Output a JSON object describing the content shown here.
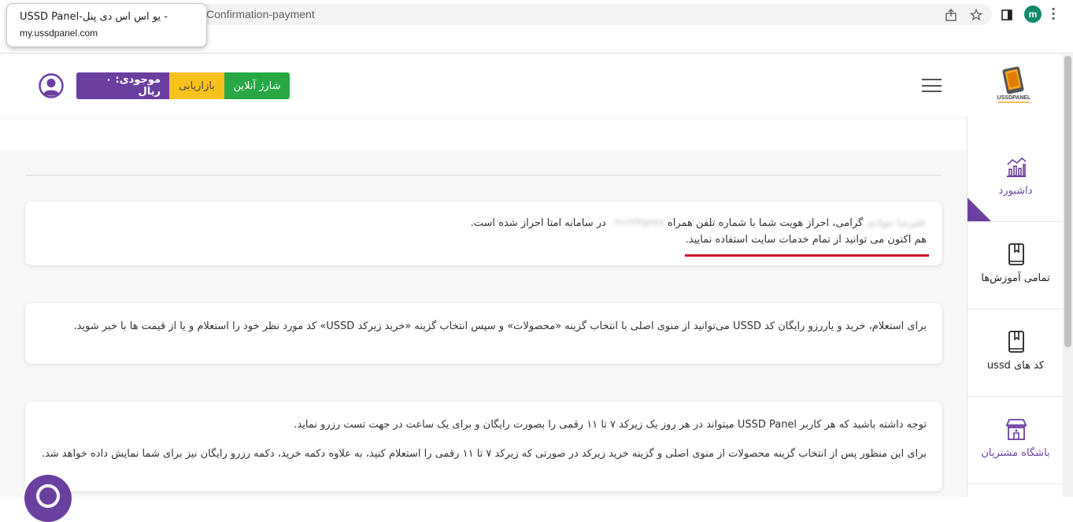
{
  "browser": {
    "address_text": "Confirmation-payment",
    "tooltip_title": "USSD Panel-یو اس اس دی پنل -",
    "tooltip_url": "my.ussdpanel.com",
    "profile_initial": "m"
  },
  "header": {
    "balance_label": "موجودی: ۰ ریال",
    "marketing_label": "بازاریابی",
    "charge_label": "شارژ آنلاین",
    "logo_text": "USSDPANEL"
  },
  "sidebar": {
    "items": [
      {
        "label": "داشبورد",
        "icon": "chart-icon",
        "active": true
      },
      {
        "label": "تمامی آموزش‌ها",
        "icon": "book-icon"
      },
      {
        "label": "کد های ussd",
        "icon": "book-icon"
      },
      {
        "label": "باشگاه مشتریان",
        "icon": "store-icon"
      }
    ]
  },
  "cards": {
    "verify_name": "علیرضا جوادی",
    "verify_line1_a": "گرامی، احراز هویت شما با شماره تلفن همراه",
    "verify_phone": "۰۹۱۲۳۴۵۶۷۸",
    "verify_line1_b": "در سامانه امتا احراز شده است.",
    "verify_line2": "هم اکنون می توانید از تمام خدمات سایت استفاده نمایید.",
    "info_text": "برای استعلام، خرید و یاررزو رایگان کد USSD می‌توانید از منوی اصلی با انتخاب گزینه «محصولات» و سپس انتخاب گزینه «خرید زیرکد USSD» کد مورد نظر خود را استعلام و یا از قیمت ها با خبر شوید.",
    "note_line1": "توجه داشته باشید که هر کاربر USSD Panel میتواند در هر روز یک زیرکد ۷ تا ۱۱ رقمی را بصورت رایگان و برای یک ساعت در جهت تست رزرو نماید.",
    "note_line2": "برای این منظور پس از انتخاب گزینه محصولات از منوی اصلی و گزینه خرید زیرکد در صورتی که زیرکد ۷ تا ۱۱ رقمی را استعلام کنید، به علاوه دکمه خرید، دکمه رزرو رایگان نیز برای شما نمایش داده خواهد شد."
  },
  "colors": {
    "purple": "#6b3fa0",
    "green": "#28a745",
    "yellow": "#f7c21b",
    "red_underline": "#d0102b"
  }
}
